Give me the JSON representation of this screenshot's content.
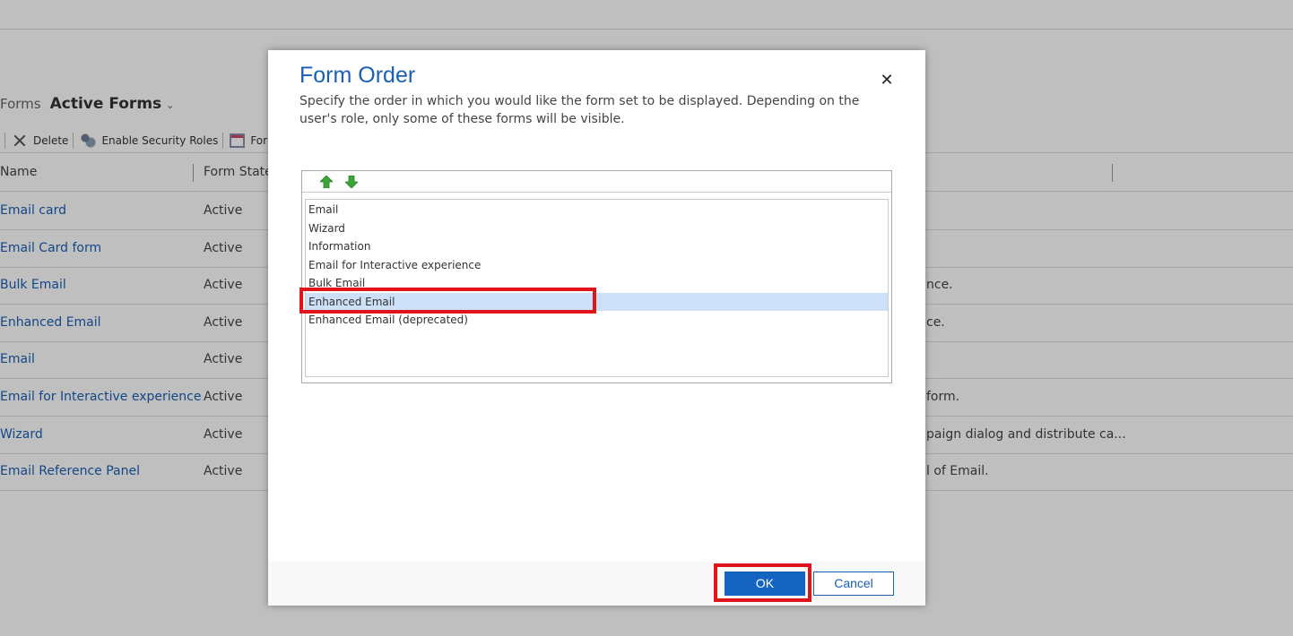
{
  "background": {
    "breadcrumb": {
      "forms": "Forms",
      "view": "Active Forms",
      "chevron": "⌄"
    },
    "toolbar": {
      "delete_label": "Delete",
      "security_label": "Enable Security Roles",
      "form_label": "For"
    },
    "grid": {
      "columns": {
        "name": "Name",
        "state": "Form State"
      },
      "rows": [
        {
          "name": "Email card",
          "state": "Active",
          "desc": ""
        },
        {
          "name": "Email Card form",
          "state": "Active",
          "desc": ""
        },
        {
          "name": "Bulk Email",
          "state": "Active",
          "desc": "nce."
        },
        {
          "name": "Enhanced Email",
          "state": "Active",
          "desc": "ce."
        },
        {
          "name": "Email",
          "state": "Active",
          "desc": ""
        },
        {
          "name": "Email for Interactive experience",
          "state": "Active",
          "desc": "form."
        },
        {
          "name": "Wizard",
          "state": "Active",
          "desc": "paign dialog and distribute ca..."
        },
        {
          "name": "Email Reference Panel",
          "state": "Active",
          "desc": "l of Email."
        }
      ]
    }
  },
  "dialog": {
    "title": "Form Order",
    "close_glyph": "✕",
    "description": "Specify the order in which you would like the form set to be displayed. Depending on the user's role, only some of these forms will be visible.",
    "order_items": [
      "Email",
      "Wizard",
      "Information",
      "Email for Interactive experience",
      "Bulk Email",
      "Enhanced Email",
      "Enhanced Email (deprecated)"
    ],
    "selected_index": 5,
    "ok_label": "OK",
    "cancel_label": "Cancel"
  },
  "icons": {
    "move_up": "green-up-arrow-icon",
    "move_down": "green-down-arrow-icon",
    "delete": "x-icon",
    "security": "security-roles-icon",
    "form_order": "form-order-icon"
  },
  "colors": {
    "accent": "#1565c0",
    "link": "#1a5fb4",
    "highlight": "#e0151c",
    "selection": "#cce0f7",
    "arrow": "#3aa635"
  }
}
